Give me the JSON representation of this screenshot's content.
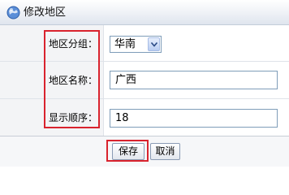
{
  "header": {
    "title": "修改地区",
    "icon": "globe-icon"
  },
  "form": {
    "region_group": {
      "label": "地区分组：",
      "selected": "华南"
    },
    "region_name": {
      "label": "地区名称：",
      "value": "广西"
    },
    "display_order": {
      "label": "显示顺序：",
      "value": "18"
    }
  },
  "actions": {
    "save_label": "保存",
    "cancel_label": "取消"
  },
  "colors": {
    "highlight": "#d9232e",
    "label_bg": "#f3f4f6",
    "input_border": "#7f9db9"
  }
}
